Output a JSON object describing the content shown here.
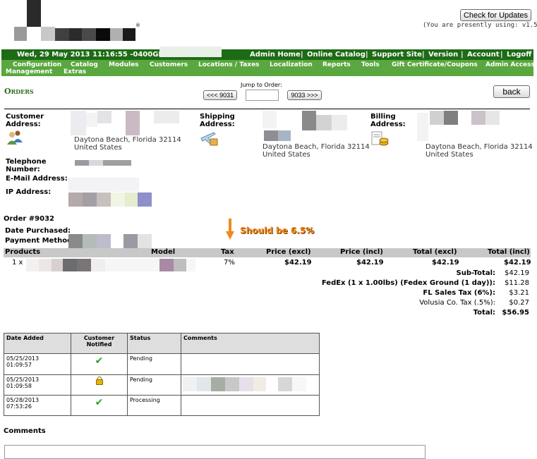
{
  "header": {
    "check_updates_label": "Check for Updates",
    "version_text": "(You are presently using: v1.5.1)",
    "registered_mark": "®"
  },
  "topbar": {
    "datetime": "Wed, 29 May 2013 11:16:55 -0400GMT",
    "links": [
      "Admin Home",
      "Online Catalog",
      "Support Site",
      "Version",
      "Account",
      "Logoff"
    ]
  },
  "nav": {
    "items": [
      "Configuration",
      "Catalog",
      "Modules",
      "Customers",
      "Locations / Taxes",
      "Localization",
      "Reports",
      "Tools",
      "Gift Certificate/Coupons",
      "Admin Access"
    ],
    "items_row2": [
      "Management",
      "Extras"
    ]
  },
  "orders": {
    "title": "Orders",
    "jump_label": "Jump to Order:",
    "prev_label": "<<< 9031",
    "next_label": "9033 >>>",
    "back_label": "back"
  },
  "customer": {
    "address_label": "Customer Address:",
    "address_city": "Daytona Beach, Florida 32114",
    "address_country": "United States",
    "telephone_label": "Telephone Number:",
    "email_label": "E-Mail Address:",
    "ip_label": "IP Address:"
  },
  "shipping": {
    "label": "Shipping Address:",
    "city": "Daytona Beach, Florida 32114",
    "country": "United States"
  },
  "billing": {
    "label": "Billing Address:",
    "city": "Daytona Beach, Florida 32114",
    "country": "United States"
  },
  "order": {
    "number": "Order #9032",
    "date_label": "Date Purchased:",
    "payment_label": "Payment Method:",
    "annotation": "Should be 6.5%"
  },
  "products": {
    "headers": [
      "Products",
      "Model",
      "Tax",
      "Price (excl)",
      "Price (incl)",
      "Total (excl)",
      "Total (incl)"
    ],
    "row": {
      "qty": "1 x",
      "tax": "7%",
      "price_excl": "$42.19",
      "price_incl": "$42.19",
      "total_excl": "$42.19",
      "total_incl": "$42.19"
    }
  },
  "totals": [
    {
      "label": "Sub-Total:",
      "value": "$42.19",
      "bold": true
    },
    {
      "label": "FedEx (1 x 1.00lbs) (Fedex Ground (1 day)):",
      "value": "$11.28",
      "bold": true
    },
    {
      "label": "FL Sales Tax (6%):",
      "value": "$3.21",
      "bold": true
    },
    {
      "label": "Volusia Co. Tax (.5%):",
      "value": "$0.27",
      "bold": false
    },
    {
      "label": "Total:",
      "value": "$56.95",
      "bold": true
    }
  ],
  "history": {
    "headers": [
      "Date Added",
      "Customer Notified",
      "Status",
      "Comments"
    ],
    "rows": [
      {
        "date": "05/25/2013",
        "time": "01:09:57",
        "notified": "check",
        "status": "Pending"
      },
      {
        "date": "05/25/2013",
        "time": "01:09:58",
        "notified": "lock",
        "status": "Pending"
      },
      {
        "date": "05/28/2013",
        "time": "07:53:26",
        "notified": "check",
        "status": "Processing"
      }
    ]
  },
  "comments_label": "Comments",
  "colors": {
    "topbar": "#1e6b16",
    "navbar": "#5aa73f",
    "annotation": "#f08a1c"
  }
}
